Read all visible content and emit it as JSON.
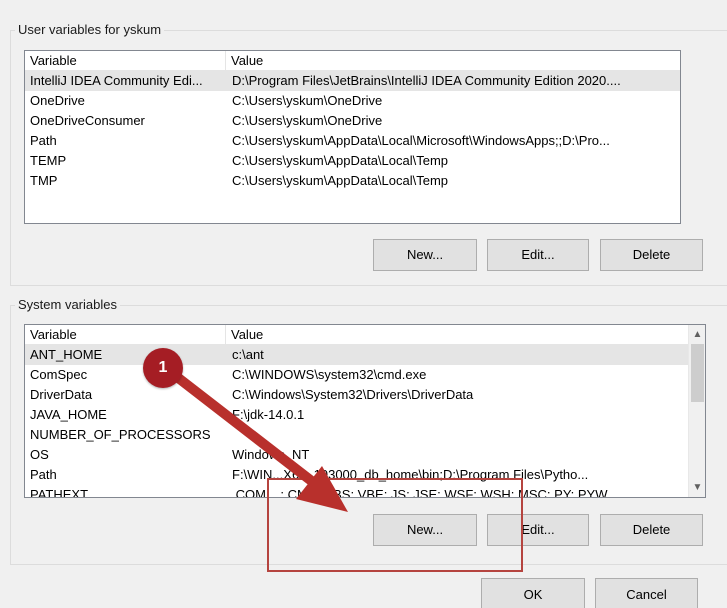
{
  "user_vars": {
    "group_label": "User variables for yskum",
    "columns": [
      "Variable",
      "Value"
    ],
    "rows": [
      {
        "variable": "IntelliJ IDEA Community Edi...",
        "value": "D:\\Program Files\\JetBrains\\IntelliJ IDEA Community Edition 2020....",
        "selected": true
      },
      {
        "variable": "OneDrive",
        "value": "C:\\Users\\yskum\\OneDrive"
      },
      {
        "variable": "OneDriveConsumer",
        "value": "C:\\Users\\yskum\\OneDrive"
      },
      {
        "variable": "Path",
        "value": "C:\\Users\\yskum\\AppData\\Local\\Microsoft\\WindowsApps;;D:\\Pro..."
      },
      {
        "variable": "TEMP",
        "value": "C:\\Users\\yskum\\AppData\\Local\\Temp"
      },
      {
        "variable": "TMP",
        "value": "C:\\Users\\yskum\\AppData\\Local\\Temp"
      }
    ],
    "buttons": {
      "new": "New...",
      "edit": "Edit...",
      "delete": "Delete"
    }
  },
  "system_vars": {
    "group_label": "System variables",
    "columns": [
      "Variable",
      "Value"
    ],
    "rows": [
      {
        "variable": "ANT_HOME",
        "value": "c:\\ant",
        "selected": true
      },
      {
        "variable": "ComSpec",
        "value": "C:\\WINDOWS\\system32\\cmd.exe"
      },
      {
        "variable": "DriverData",
        "value": "C:\\Windows\\System32\\Drivers\\DriverData"
      },
      {
        "variable": "JAVA_HOME",
        "value": "F:\\jdk-14.0.1"
      },
      {
        "variable": "NUMBER_OF_PROCESSORS",
        "value": ""
      },
      {
        "variable": "OS",
        "value": "Windows_NT"
      },
      {
        "variable": "Path",
        "value": "F:\\WIN...X64_193000_db_home\\bin;D:\\Program Files\\Pytho..."
      },
      {
        "variable": "PATHEXT",
        "value": ".COM;...;.CMD;.VBS;.VBE;.JS;.JSE;.WSF;.WSH;.MSC;.PY;.PYW"
      }
    ],
    "buttons": {
      "new": "New...",
      "edit": "Edit...",
      "delete": "Delete"
    }
  },
  "dialog_buttons": {
    "ok": "OK",
    "cancel": "Cancel"
  },
  "annotation": {
    "step_number": "1"
  },
  "colors": {
    "annotation_red": "#a51d24",
    "highlight_border": "#b5443f",
    "arrow": "#b8302c"
  }
}
